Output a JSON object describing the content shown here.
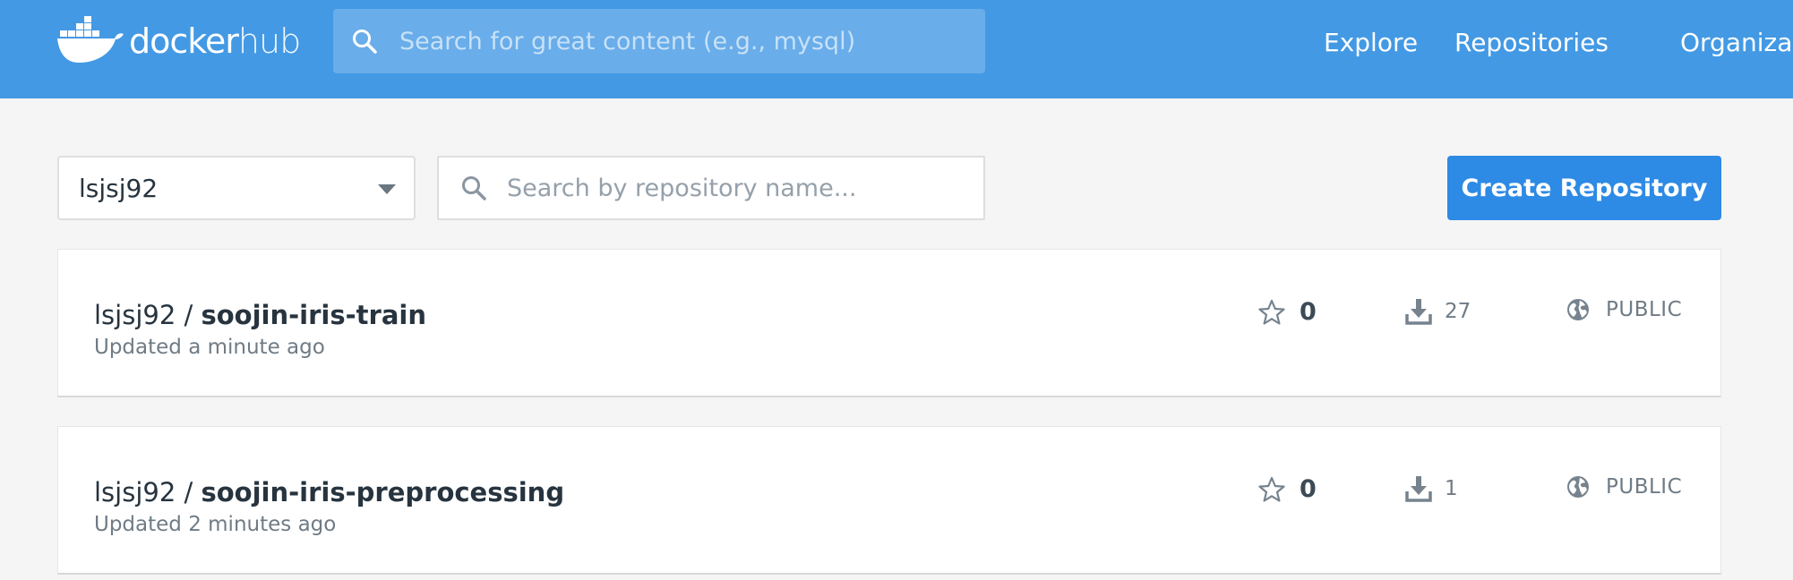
{
  "header": {
    "logo_text_main": "docker",
    "logo_text_sub": "hub",
    "search_placeholder": "Search for great content (e.g., mysql)",
    "nav": [
      "Explore",
      "Repositories",
      "Organizat"
    ],
    "brand_color": "#4399e4"
  },
  "toolbar": {
    "owner_selected": "lsjsj92",
    "repo_search_placeholder": "Search by repository name...",
    "create_label": "Create Repository"
  },
  "repositories": [
    {
      "owner": "lsjsj92 / ",
      "name": "soojin-iris-train",
      "updated": "Updated a minute ago",
      "stars": "0",
      "pulls": "27",
      "visibility": "PUBLIC"
    },
    {
      "owner": "lsjsj92 / ",
      "name": "soojin-iris-preprocessing",
      "updated": "Updated 2 minutes ago",
      "stars": "0",
      "pulls": "1",
      "visibility": "PUBLIC"
    }
  ],
  "icons": {
    "logo": "docker-whale-icon",
    "search": "search-icon",
    "dropdown": "caret-down-icon",
    "star": "star-icon",
    "pulls": "download-icon",
    "visibility": "globe-icon"
  }
}
